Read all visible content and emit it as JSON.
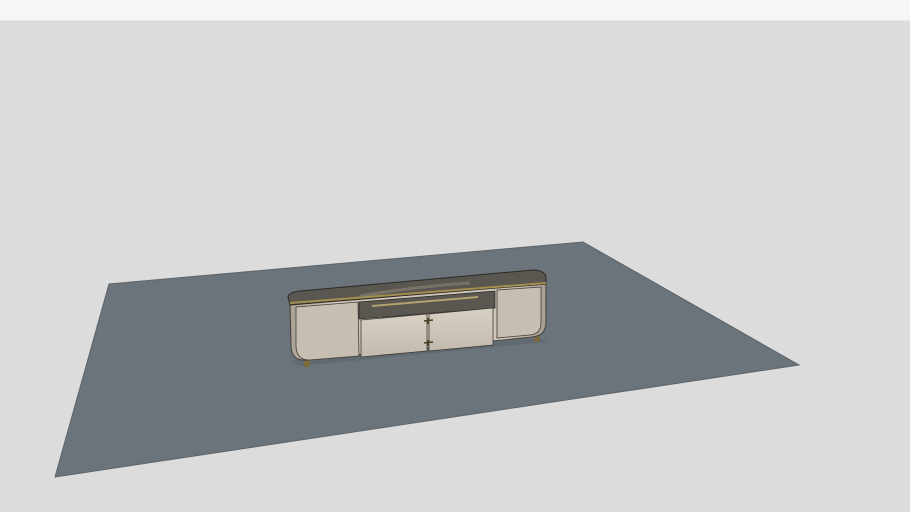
{
  "app": {
    "toolbar_title": ""
  },
  "colors": {
    "background": "#dcdcdc",
    "toolbar": "#f6f6f6",
    "rug": "#6b747a",
    "cabinet_body": "#c9c1b4",
    "cabinet_top": "#5a5650",
    "brass_trim": "#a38f4e"
  },
  "scene": {
    "objects": [
      {
        "name": "rug",
        "icon": "rug-plane"
      },
      {
        "name": "tv-cabinet",
        "icon": "cabinet-model"
      }
    ]
  }
}
